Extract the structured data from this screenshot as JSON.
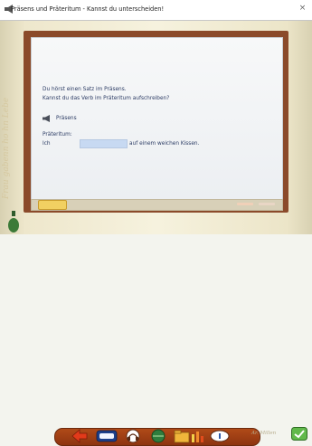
{
  "window": {
    "title": "Präsens und Präteritum - Kannst du unterscheiden!",
    "close_label": "×"
  },
  "deco": {
    "left_handwriting": "Frau gabenn ho hn Lebe"
  },
  "exercise": {
    "instruction_line1": "Du hörst einen Satz im Präsens.",
    "instruction_line2": "Kannst du das Verb im Präteritum aufschreiben?",
    "sound_label": "Präsens",
    "answer_heading": "Präteritum:",
    "sentence_before": "Ich",
    "answer_value": "",
    "sentence_after": "auf einem weichen Kissen."
  },
  "footer": {
    "signature": "Ar. Millen"
  },
  "toolbar": {
    "icons": [
      "red-arrow-icon",
      "card-icon",
      "headphones-icon",
      "ball-icon",
      "folder-icon",
      "chart-icon",
      "info-icon"
    ]
  },
  "colors": {
    "board_frame": "#8b4a2a",
    "text": "#2c3c64",
    "input_highlight": "#c7d9f2",
    "toolbar": "#9e4115"
  }
}
